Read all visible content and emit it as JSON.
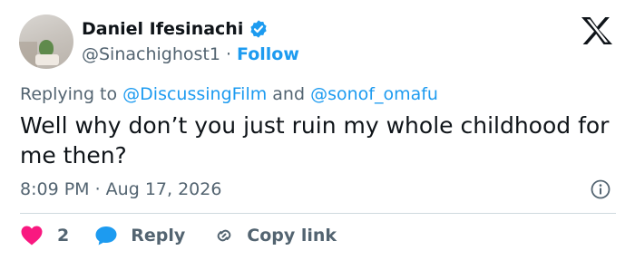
{
  "author": {
    "display_name": "Daniel Ifesinachi",
    "handle": "@Sinachighost1",
    "separator": "·",
    "follow_label": "Follow",
    "verified_icon": "verified-badge-icon"
  },
  "replying": {
    "prefix": "Replying to ",
    "mention_1": "@DiscussingFilm",
    "conjunction": " and ",
    "mention_2": "@sonof_omafu"
  },
  "tweet": {
    "text": "Well why don’t you just ruin my whole childhood for me then?",
    "timestamp": "8:09 PM · Aug 17, 2026"
  },
  "actions": {
    "like_count": "2",
    "reply_label": "Reply",
    "copy_label": "Copy link"
  },
  "colors": {
    "accent": "#1d9bf0",
    "like": "#f91880",
    "secondary_text": "#536471",
    "primary_text": "#0f1419",
    "divider": "#cfd9de"
  }
}
